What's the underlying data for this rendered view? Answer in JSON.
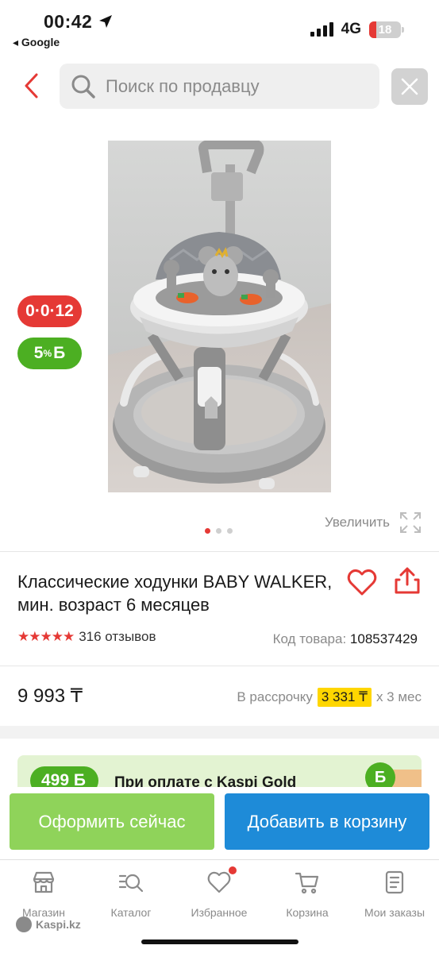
{
  "status_bar": {
    "time": "00:42",
    "back_app": "◂ Google",
    "network": "4G",
    "battery": "18"
  },
  "search": {
    "placeholder": "Поиск по продавцу"
  },
  "product": {
    "badges": {
      "installment": "0·0·12",
      "bonus_percent": "5",
      "bonus_unit": "%",
      "bonus_currency": "Б"
    },
    "image_pages": 3,
    "image_active_page": 1,
    "zoom_label": "Увеличить",
    "title": "Классические ходунки BABY WALKER, мин. возраст 6 месяцев",
    "rating": 4.5,
    "stars": "★★★★★",
    "reviews": "316 отзывов",
    "code_label": "Код товара:",
    "code_value": "108537429",
    "price": "9 993 ₸",
    "installment_prefix": "В рассрочку",
    "installment_amount": "3 331 ₸",
    "installment_suffix": "x 3 мес"
  },
  "promo": {
    "bonus": "499 Б",
    "text": "При оплате с Kaspi Gold",
    "coin": "Б"
  },
  "actions": {
    "checkout": "Оформить сейчас",
    "add_to_cart": "Добавить в корзину"
  },
  "bottom_nav": {
    "items": [
      {
        "label": "Магазин",
        "icon": "shop-icon"
      },
      {
        "label": "Каталог",
        "icon": "catalog-search-icon"
      },
      {
        "label": "Избранное",
        "icon": "heart-icon"
      },
      {
        "label": "Корзина",
        "icon": "cart-icon"
      },
      {
        "label": "Мои заказы",
        "icon": "orders-icon"
      }
    ],
    "brand": "Kaspi.kz"
  },
  "colors": {
    "accent_red": "#e53935",
    "bonus_green": "#4caf22",
    "checkout_green": "#8fd35a",
    "cart_blue": "#1e8bd8",
    "highlight_yellow": "#ffd600"
  }
}
